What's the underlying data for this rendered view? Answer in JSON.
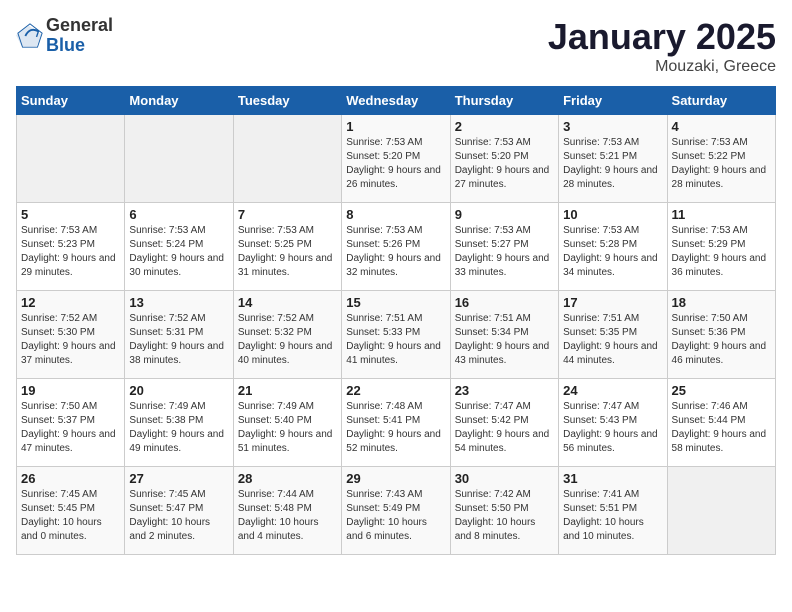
{
  "logo": {
    "general": "General",
    "blue": "Blue"
  },
  "title": "January 2025",
  "subtitle": "Mouzaki, Greece",
  "days_of_week": [
    "Sunday",
    "Monday",
    "Tuesday",
    "Wednesday",
    "Thursday",
    "Friday",
    "Saturday"
  ],
  "weeks": [
    [
      {
        "day": "",
        "sunrise": "",
        "sunset": "",
        "daylight": ""
      },
      {
        "day": "",
        "sunrise": "",
        "sunset": "",
        "daylight": ""
      },
      {
        "day": "",
        "sunrise": "",
        "sunset": "",
        "daylight": ""
      },
      {
        "day": "1",
        "sunrise": "Sunrise: 7:53 AM",
        "sunset": "Sunset: 5:20 PM",
        "daylight": "Daylight: 9 hours and 26 minutes."
      },
      {
        "day": "2",
        "sunrise": "Sunrise: 7:53 AM",
        "sunset": "Sunset: 5:20 PM",
        "daylight": "Daylight: 9 hours and 27 minutes."
      },
      {
        "day": "3",
        "sunrise": "Sunrise: 7:53 AM",
        "sunset": "Sunset: 5:21 PM",
        "daylight": "Daylight: 9 hours and 28 minutes."
      },
      {
        "day": "4",
        "sunrise": "Sunrise: 7:53 AM",
        "sunset": "Sunset: 5:22 PM",
        "daylight": "Daylight: 9 hours and 28 minutes."
      }
    ],
    [
      {
        "day": "5",
        "sunrise": "Sunrise: 7:53 AM",
        "sunset": "Sunset: 5:23 PM",
        "daylight": "Daylight: 9 hours and 29 minutes."
      },
      {
        "day": "6",
        "sunrise": "Sunrise: 7:53 AM",
        "sunset": "Sunset: 5:24 PM",
        "daylight": "Daylight: 9 hours and 30 minutes."
      },
      {
        "day": "7",
        "sunrise": "Sunrise: 7:53 AM",
        "sunset": "Sunset: 5:25 PM",
        "daylight": "Daylight: 9 hours and 31 minutes."
      },
      {
        "day": "8",
        "sunrise": "Sunrise: 7:53 AM",
        "sunset": "Sunset: 5:26 PM",
        "daylight": "Daylight: 9 hours and 32 minutes."
      },
      {
        "day": "9",
        "sunrise": "Sunrise: 7:53 AM",
        "sunset": "Sunset: 5:27 PM",
        "daylight": "Daylight: 9 hours and 33 minutes."
      },
      {
        "day": "10",
        "sunrise": "Sunrise: 7:53 AM",
        "sunset": "Sunset: 5:28 PM",
        "daylight": "Daylight: 9 hours and 34 minutes."
      },
      {
        "day": "11",
        "sunrise": "Sunrise: 7:53 AM",
        "sunset": "Sunset: 5:29 PM",
        "daylight": "Daylight: 9 hours and 36 minutes."
      }
    ],
    [
      {
        "day": "12",
        "sunrise": "Sunrise: 7:52 AM",
        "sunset": "Sunset: 5:30 PM",
        "daylight": "Daylight: 9 hours and 37 minutes."
      },
      {
        "day": "13",
        "sunrise": "Sunrise: 7:52 AM",
        "sunset": "Sunset: 5:31 PM",
        "daylight": "Daylight: 9 hours and 38 minutes."
      },
      {
        "day": "14",
        "sunrise": "Sunrise: 7:52 AM",
        "sunset": "Sunset: 5:32 PM",
        "daylight": "Daylight: 9 hours and 40 minutes."
      },
      {
        "day": "15",
        "sunrise": "Sunrise: 7:51 AM",
        "sunset": "Sunset: 5:33 PM",
        "daylight": "Daylight: 9 hours and 41 minutes."
      },
      {
        "day": "16",
        "sunrise": "Sunrise: 7:51 AM",
        "sunset": "Sunset: 5:34 PM",
        "daylight": "Daylight: 9 hours and 43 minutes."
      },
      {
        "day": "17",
        "sunrise": "Sunrise: 7:51 AM",
        "sunset": "Sunset: 5:35 PM",
        "daylight": "Daylight: 9 hours and 44 minutes."
      },
      {
        "day": "18",
        "sunrise": "Sunrise: 7:50 AM",
        "sunset": "Sunset: 5:36 PM",
        "daylight": "Daylight: 9 hours and 46 minutes."
      }
    ],
    [
      {
        "day": "19",
        "sunrise": "Sunrise: 7:50 AM",
        "sunset": "Sunset: 5:37 PM",
        "daylight": "Daylight: 9 hours and 47 minutes."
      },
      {
        "day": "20",
        "sunrise": "Sunrise: 7:49 AM",
        "sunset": "Sunset: 5:38 PM",
        "daylight": "Daylight: 9 hours and 49 minutes."
      },
      {
        "day": "21",
        "sunrise": "Sunrise: 7:49 AM",
        "sunset": "Sunset: 5:40 PM",
        "daylight": "Daylight: 9 hours and 51 minutes."
      },
      {
        "day": "22",
        "sunrise": "Sunrise: 7:48 AM",
        "sunset": "Sunset: 5:41 PM",
        "daylight": "Daylight: 9 hours and 52 minutes."
      },
      {
        "day": "23",
        "sunrise": "Sunrise: 7:47 AM",
        "sunset": "Sunset: 5:42 PM",
        "daylight": "Daylight: 9 hours and 54 minutes."
      },
      {
        "day": "24",
        "sunrise": "Sunrise: 7:47 AM",
        "sunset": "Sunset: 5:43 PM",
        "daylight": "Daylight: 9 hours and 56 minutes."
      },
      {
        "day": "25",
        "sunrise": "Sunrise: 7:46 AM",
        "sunset": "Sunset: 5:44 PM",
        "daylight": "Daylight: 9 hours and 58 minutes."
      }
    ],
    [
      {
        "day": "26",
        "sunrise": "Sunrise: 7:45 AM",
        "sunset": "Sunset: 5:45 PM",
        "daylight": "Daylight: 10 hours and 0 minutes."
      },
      {
        "day": "27",
        "sunrise": "Sunrise: 7:45 AM",
        "sunset": "Sunset: 5:47 PM",
        "daylight": "Daylight: 10 hours and 2 minutes."
      },
      {
        "day": "28",
        "sunrise": "Sunrise: 7:44 AM",
        "sunset": "Sunset: 5:48 PM",
        "daylight": "Daylight: 10 hours and 4 minutes."
      },
      {
        "day": "29",
        "sunrise": "Sunrise: 7:43 AM",
        "sunset": "Sunset: 5:49 PM",
        "daylight": "Daylight: 10 hours and 6 minutes."
      },
      {
        "day": "30",
        "sunrise": "Sunrise: 7:42 AM",
        "sunset": "Sunset: 5:50 PM",
        "daylight": "Daylight: 10 hours and 8 minutes."
      },
      {
        "day": "31",
        "sunrise": "Sunrise: 7:41 AM",
        "sunset": "Sunset: 5:51 PM",
        "daylight": "Daylight: 10 hours and 10 minutes."
      },
      {
        "day": "",
        "sunrise": "",
        "sunset": "",
        "daylight": ""
      }
    ]
  ]
}
